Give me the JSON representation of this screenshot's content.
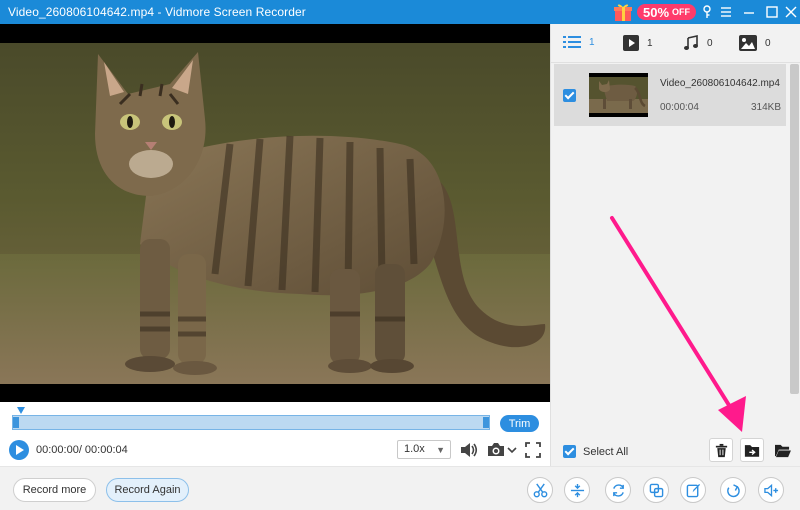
{
  "window": {
    "title": "Video_260806104642.mp4   -   Vidmore Screen Recorder",
    "promo": {
      "percent": "50%",
      "label": "OFF"
    }
  },
  "player": {
    "time": "00:00:00/ 00:00:04",
    "speed": "1.0x",
    "trim_label": "Trim",
    "progress": 0.0
  },
  "bottom_bar": {
    "record_more": "Record more",
    "record_again": "Record Again",
    "tools": [
      "scissors-icon",
      "merge-icon",
      "rotate-icon",
      "compress-icon",
      "edit-icon",
      "convert-icon",
      "volume-icon"
    ]
  },
  "panel": {
    "tabs": [
      {
        "icon": "list-icon",
        "count": "1"
      },
      {
        "icon": "video-icon",
        "count": "1"
      },
      {
        "icon": "music-icon",
        "count": "0"
      },
      {
        "icon": "image-icon",
        "count": "0"
      }
    ],
    "files": [
      {
        "name": "Video_260806104642.mp4",
        "duration": "00:00:04",
        "size": "314KB",
        "checked": true
      }
    ],
    "select_all": "Select All"
  },
  "colors": {
    "accent": "#2d8ee0",
    "titlebar": "#1b8ad8",
    "promo": "#ff3b6b",
    "annotation_arrow": "#ff1a8c"
  }
}
